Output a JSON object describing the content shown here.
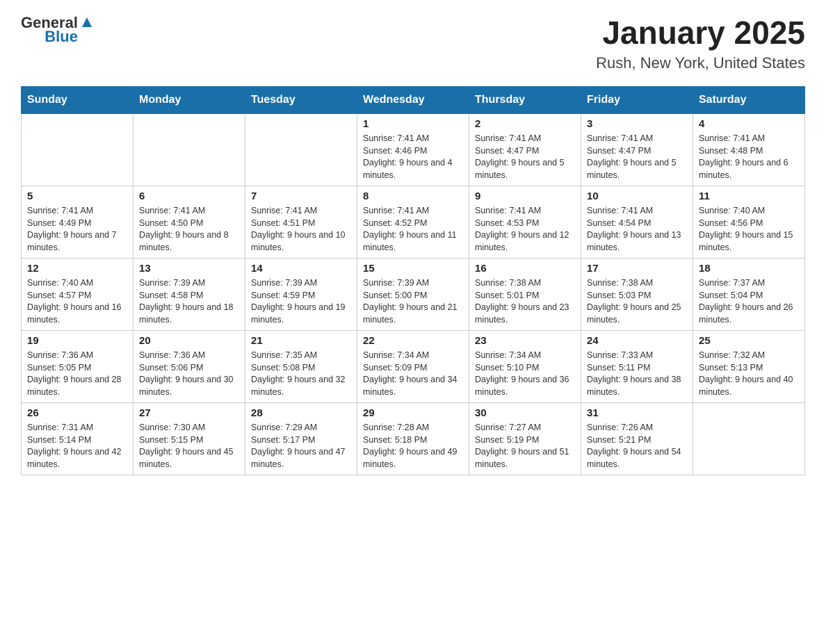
{
  "header": {
    "logo": {
      "text_general": "General",
      "text_blue": "Blue",
      "triangle_symbol": "▲"
    },
    "title": "January 2025",
    "location": "Rush, New York, United States"
  },
  "calendar": {
    "days_of_week": [
      "Sunday",
      "Monday",
      "Tuesday",
      "Wednesday",
      "Thursday",
      "Friday",
      "Saturday"
    ],
    "weeks": [
      {
        "days": [
          {
            "number": "",
            "info": ""
          },
          {
            "number": "",
            "info": ""
          },
          {
            "number": "",
            "info": ""
          },
          {
            "number": "1",
            "info": "Sunrise: 7:41 AM\nSunset: 4:46 PM\nDaylight: 9 hours and 4 minutes."
          },
          {
            "number": "2",
            "info": "Sunrise: 7:41 AM\nSunset: 4:47 PM\nDaylight: 9 hours and 5 minutes."
          },
          {
            "number": "3",
            "info": "Sunrise: 7:41 AM\nSunset: 4:47 PM\nDaylight: 9 hours and 5 minutes."
          },
          {
            "number": "4",
            "info": "Sunrise: 7:41 AM\nSunset: 4:48 PM\nDaylight: 9 hours and 6 minutes."
          }
        ]
      },
      {
        "days": [
          {
            "number": "5",
            "info": "Sunrise: 7:41 AM\nSunset: 4:49 PM\nDaylight: 9 hours and 7 minutes."
          },
          {
            "number": "6",
            "info": "Sunrise: 7:41 AM\nSunset: 4:50 PM\nDaylight: 9 hours and 8 minutes."
          },
          {
            "number": "7",
            "info": "Sunrise: 7:41 AM\nSunset: 4:51 PM\nDaylight: 9 hours and 10 minutes."
          },
          {
            "number": "8",
            "info": "Sunrise: 7:41 AM\nSunset: 4:52 PM\nDaylight: 9 hours and 11 minutes."
          },
          {
            "number": "9",
            "info": "Sunrise: 7:41 AM\nSunset: 4:53 PM\nDaylight: 9 hours and 12 minutes."
          },
          {
            "number": "10",
            "info": "Sunrise: 7:41 AM\nSunset: 4:54 PM\nDaylight: 9 hours and 13 minutes."
          },
          {
            "number": "11",
            "info": "Sunrise: 7:40 AM\nSunset: 4:56 PM\nDaylight: 9 hours and 15 minutes."
          }
        ]
      },
      {
        "days": [
          {
            "number": "12",
            "info": "Sunrise: 7:40 AM\nSunset: 4:57 PM\nDaylight: 9 hours and 16 minutes."
          },
          {
            "number": "13",
            "info": "Sunrise: 7:39 AM\nSunset: 4:58 PM\nDaylight: 9 hours and 18 minutes."
          },
          {
            "number": "14",
            "info": "Sunrise: 7:39 AM\nSunset: 4:59 PM\nDaylight: 9 hours and 19 minutes."
          },
          {
            "number": "15",
            "info": "Sunrise: 7:39 AM\nSunset: 5:00 PM\nDaylight: 9 hours and 21 minutes."
          },
          {
            "number": "16",
            "info": "Sunrise: 7:38 AM\nSunset: 5:01 PM\nDaylight: 9 hours and 23 minutes."
          },
          {
            "number": "17",
            "info": "Sunrise: 7:38 AM\nSunset: 5:03 PM\nDaylight: 9 hours and 25 minutes."
          },
          {
            "number": "18",
            "info": "Sunrise: 7:37 AM\nSunset: 5:04 PM\nDaylight: 9 hours and 26 minutes."
          }
        ]
      },
      {
        "days": [
          {
            "number": "19",
            "info": "Sunrise: 7:36 AM\nSunset: 5:05 PM\nDaylight: 9 hours and 28 minutes."
          },
          {
            "number": "20",
            "info": "Sunrise: 7:36 AM\nSunset: 5:06 PM\nDaylight: 9 hours and 30 minutes."
          },
          {
            "number": "21",
            "info": "Sunrise: 7:35 AM\nSunset: 5:08 PM\nDaylight: 9 hours and 32 minutes."
          },
          {
            "number": "22",
            "info": "Sunrise: 7:34 AM\nSunset: 5:09 PM\nDaylight: 9 hours and 34 minutes."
          },
          {
            "number": "23",
            "info": "Sunrise: 7:34 AM\nSunset: 5:10 PM\nDaylight: 9 hours and 36 minutes."
          },
          {
            "number": "24",
            "info": "Sunrise: 7:33 AM\nSunset: 5:11 PM\nDaylight: 9 hours and 38 minutes."
          },
          {
            "number": "25",
            "info": "Sunrise: 7:32 AM\nSunset: 5:13 PM\nDaylight: 9 hours and 40 minutes."
          }
        ]
      },
      {
        "days": [
          {
            "number": "26",
            "info": "Sunrise: 7:31 AM\nSunset: 5:14 PM\nDaylight: 9 hours and 42 minutes."
          },
          {
            "number": "27",
            "info": "Sunrise: 7:30 AM\nSunset: 5:15 PM\nDaylight: 9 hours and 45 minutes."
          },
          {
            "number": "28",
            "info": "Sunrise: 7:29 AM\nSunset: 5:17 PM\nDaylight: 9 hours and 47 minutes."
          },
          {
            "number": "29",
            "info": "Sunrise: 7:28 AM\nSunset: 5:18 PM\nDaylight: 9 hours and 49 minutes."
          },
          {
            "number": "30",
            "info": "Sunrise: 7:27 AM\nSunset: 5:19 PM\nDaylight: 9 hours and 51 minutes."
          },
          {
            "number": "31",
            "info": "Sunrise: 7:26 AM\nSunset: 5:21 PM\nDaylight: 9 hours and 54 minutes."
          },
          {
            "number": "",
            "info": ""
          }
        ]
      }
    ]
  }
}
